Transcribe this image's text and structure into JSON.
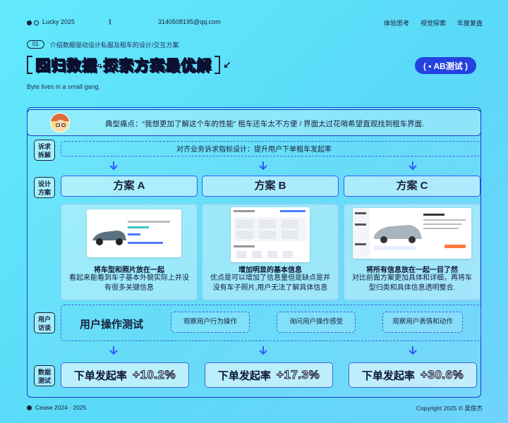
{
  "topbar": {
    "brand": "Lucky 2025",
    "deco": "∥",
    "email": "3140508195@qq.com",
    "nav": [
      "体验思考",
      "视觉探索",
      "年度复盘"
    ]
  },
  "subtitle": {
    "num": "01",
    "text": "介绍数据驱动设计私服及租车的设计/交互方案"
  },
  "title": {
    "part1": "回归",
    "highlight": "数据",
    "part2": "·探索方案最优解",
    "arrow": "↙"
  },
  "ab_pill": "( • AB测试 )",
  "tagline": "Byte lives in a small gang.",
  "pain": {
    "text": "典型痛点：“我想更加了解这个车的性能” 租车还车太不方便 / 界面太过花哨希望直观找到租车界面."
  },
  "rows": {
    "req": [
      "诉求",
      "拆解"
    ],
    "design": [
      "设计",
      "方案"
    ],
    "user": [
      "用户",
      "访谈"
    ],
    "data": [
      "数据",
      "测试"
    ]
  },
  "goal": "对齐业务诉求指标设计：提升用户下单租车发起率",
  "schemes": [
    {
      "label": "方案 A",
      "title": "将车型和照片放在一起",
      "desc": "看起来能看到车子基本外貌实际上并没有很多关键信息"
    },
    {
      "label": "方案 B",
      "title": "增加明显的基本信息",
      "desc": "优点是可以增加了信息量但是缺点是并没有车子照片,用户无法了解具体信息"
    },
    {
      "label": "方案 C",
      "title": "将所有信息放在一起一目了然",
      "desc": "对比前面方案更加具体和详细，再将车型归类和具体信息透明整合."
    }
  ],
  "interview": {
    "title": "用户操作测试",
    "items": [
      "观察用户行为操作",
      "询问用户操作感受",
      "观察用户表情和动作"
    ]
  },
  "metrics": [
    {
      "label": "下单发起率",
      "value": "+10.2%"
    },
    {
      "label": "下单发起率",
      "value": "+17.3%"
    },
    {
      "label": "下单发起率",
      "value": "+30.6%"
    }
  ],
  "footer": {
    "left": "Cease 2024 · 2025",
    "right": "Copyright 2025 © 吴俊杰"
  },
  "colors": {
    "accent": "#2f56ff",
    "pill": "#2442e0",
    "bg_start": "#62eafc"
  }
}
